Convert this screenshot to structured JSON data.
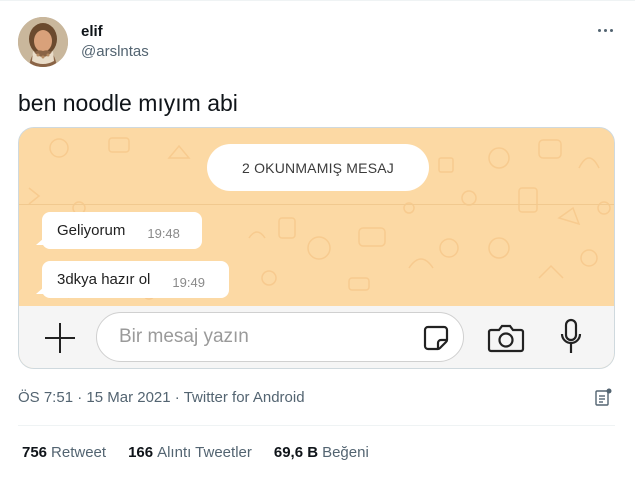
{
  "tweet": {
    "author": {
      "display_name": "elif",
      "handle": "@arslntas"
    },
    "more_icon": "more-horizontal-icon",
    "text": "ben noodle mıyım abi",
    "meta": {
      "time": "ÖS 7:51",
      "separator1": " · ",
      "date": "15 Mar 2021",
      "separator2": " · ",
      "source": "Twitter for Android"
    },
    "stats": [
      {
        "count": "756",
        "label": "Retweet"
      },
      {
        "count": "166",
        "label": "Alıntı Tweetler"
      },
      {
        "count": "69,6 B",
        "label": "Beğeni"
      }
    ]
  },
  "chat": {
    "unread_label": "2 OKUNMAMIŞ MESAJ",
    "messages": [
      {
        "text": "Geliyorum",
        "time": "19:48"
      },
      {
        "text": "3dkya hazır ol",
        "time": "19:49"
      }
    ],
    "input_placeholder": "Bir mesaj yazın",
    "icons": [
      "plus-icon",
      "sticker-icon",
      "camera-icon",
      "microphone-icon"
    ]
  },
  "colors": {
    "chat_background": "#fcd9a4",
    "secondary_text": "#536471",
    "primary_text": "#0f1419"
  }
}
